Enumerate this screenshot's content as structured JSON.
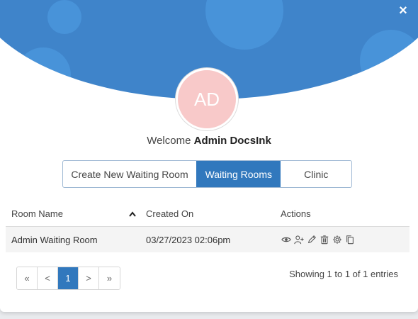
{
  "header": {
    "close_symbol": "×",
    "accent_color": "#3f84ca"
  },
  "avatar": {
    "initials": "AD",
    "color": "#f8c9c9"
  },
  "welcome": {
    "prefix": "Welcome",
    "name": "Admin DocsInk"
  },
  "tabs": [
    {
      "label": "Create New Waiting Room",
      "active": false
    },
    {
      "label": "Waiting Rooms",
      "active": true
    },
    {
      "label": "Clinic",
      "active": false
    }
  ],
  "table": {
    "columns": [
      "Room Name",
      "Created On",
      "Actions"
    ],
    "rows": [
      {
        "room_name": "Admin Waiting Room",
        "created_on": "03/27/2023 02:06pm"
      }
    ],
    "actions": [
      "view-icon",
      "add-user-icon",
      "edit-icon",
      "delete-icon",
      "settings-icon",
      "copy-icon"
    ]
  },
  "pagination": {
    "first": "«",
    "prev": "<",
    "current": "1",
    "next": ">",
    "last": "»"
  },
  "entries_text": "Showing 1 to 1 of 1 entries"
}
